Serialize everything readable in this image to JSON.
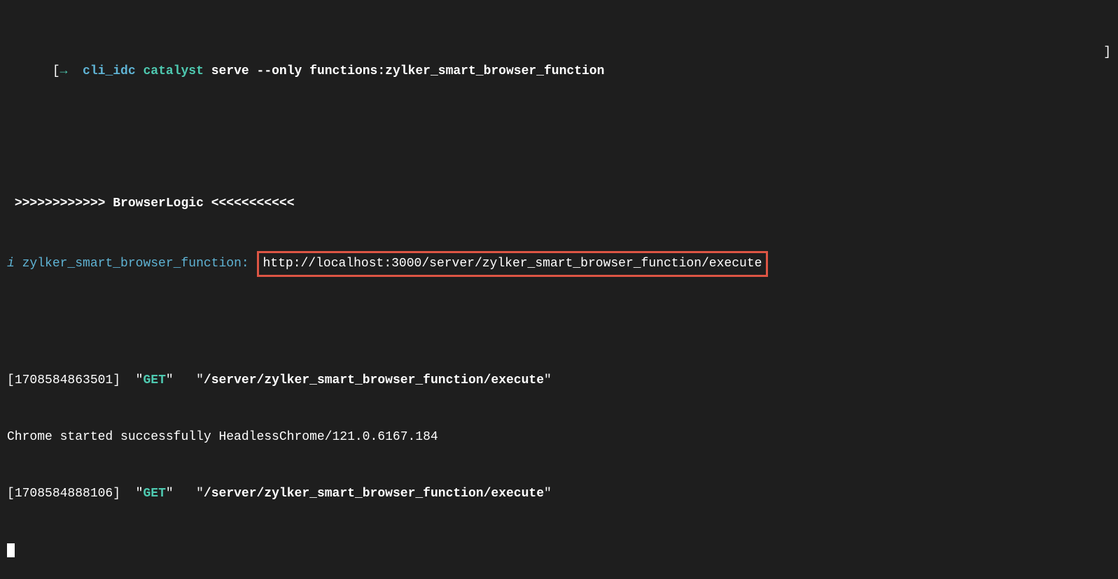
{
  "prompt": {
    "open_bracket": "[",
    "arrow": "→",
    "context": "cli_idc",
    "command_main": "catalyst",
    "command_rest": "serve --only functions:zylker_smart_browser_function",
    "close_bracket": "]"
  },
  "section": {
    "left_chevrons": ">>>>>>>>>>>>",
    "title": "BrowserLogic",
    "right_chevrons": "<<<<<<<<<<<"
  },
  "info": {
    "info_symbol": "i",
    "function_name": "zylker_smart_browser_function:",
    "url": "http://localhost:3000/server/zylker_smart_browser_function/execute"
  },
  "log1": {
    "timestamp": "1708584863501",
    "method": "GET",
    "path": "/server/zylker_smart_browser_function/execute"
  },
  "chrome_line": "Chrome started successfully HeadlessChrome/121.0.6167.184",
  "log2": {
    "timestamp": "1708584888106",
    "method": "GET",
    "path": "/server/zylker_smart_browser_function/execute"
  }
}
